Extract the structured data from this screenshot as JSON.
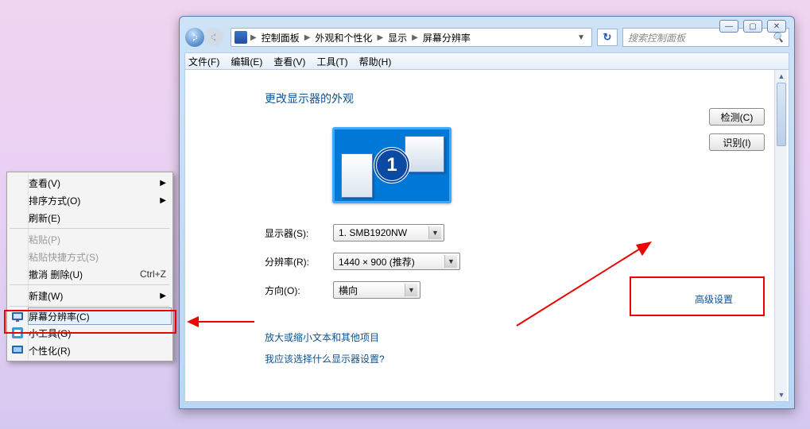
{
  "titlebar": {
    "min": "—",
    "max": "▢",
    "close": "✕"
  },
  "breadcrumb": {
    "items": [
      "控制面板",
      "外观和个性化",
      "显示",
      "屏幕分辨率"
    ]
  },
  "search": {
    "placeholder": "搜索控制面板"
  },
  "menubar": {
    "file": "文件(F)",
    "edit": "编辑(E)",
    "view": "查看(V)",
    "tools": "工具(T)",
    "help": "帮助(H)"
  },
  "content": {
    "heading": "更改显示器的外观",
    "monitor_number": "1",
    "detect": "检测(C)",
    "identify": "识别(I)",
    "display_label": "显示器(S):",
    "display_value": "1. SMB1920NW",
    "resolution_label": "分辨率(R):",
    "resolution_value": "1440 × 900 (推荐)",
    "orientation_label": "方向(O):",
    "orientation_value": "横向",
    "advanced": "高级设置",
    "link1": "放大或缩小文本和其他项目",
    "link2": "我应该选择什么显示器设置?"
  },
  "context_menu": {
    "view": "查看(V)",
    "sort": "排序方式(O)",
    "refresh": "刷新(E)",
    "paste": "粘贴(P)",
    "paste_shortcut": "粘贴快捷方式(S)",
    "undo_delete": "撤消 删除(U)",
    "undo_delete_key": "Ctrl+Z",
    "new": "新建(W)",
    "screen_res": "屏幕分辨率(C)",
    "gadgets": "小工具(G)",
    "personalize": "个性化(R)"
  }
}
